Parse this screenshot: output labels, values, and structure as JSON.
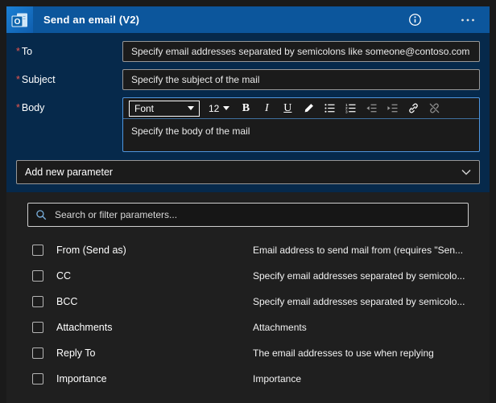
{
  "header": {
    "title": "Send an email (V2)"
  },
  "fields": {
    "to": {
      "label": "To",
      "required_marker": "*",
      "placeholder": "Specify email addresses separated by semicolons like someone@contoso.com"
    },
    "subject": {
      "label": "Subject",
      "required_marker": "*",
      "placeholder": "Specify the subject of the mail"
    },
    "body": {
      "label": "Body",
      "required_marker": "*",
      "placeholder": "Specify the body of the mail"
    }
  },
  "body_toolbar": {
    "font_label": "Font",
    "font_size": "12",
    "bold_label": "B",
    "italic_label": "I",
    "underline_label": "U",
    "icons": [
      "pen-icon",
      "bullet-list-icon",
      "numbered-list-icon",
      "outdent-icon",
      "indent-icon",
      "link-icon",
      "unlink-icon"
    ]
  },
  "add_parameter": {
    "label": "Add new parameter"
  },
  "search": {
    "placeholder": "Search or filter parameters..."
  },
  "parameters": [
    {
      "name": "From (Send as)",
      "description": "Email address to send mail from (requires \"Sen..."
    },
    {
      "name": "CC",
      "description": "Specify email addresses separated by semicolo..."
    },
    {
      "name": "BCC",
      "description": "Specify email addresses separated by semicolo..."
    },
    {
      "name": "Attachments",
      "description": "Attachments"
    },
    {
      "name": "Reply To",
      "description": "The email addresses to use when replying"
    },
    {
      "name": "Importance",
      "description": "Importance"
    }
  ],
  "colors": {
    "header_blue": "#0c569c",
    "card_blue": "#06294b",
    "panel_dark": "#1f1f1f",
    "input_dark": "#1b1b1b",
    "required_red": "#e8564f",
    "editor_border_blue": "#4f95dd"
  },
  "icons": [
    "outlook-icon",
    "info-icon",
    "ellipsis-icon",
    "chevron-down-icon",
    "search-icon"
  ]
}
